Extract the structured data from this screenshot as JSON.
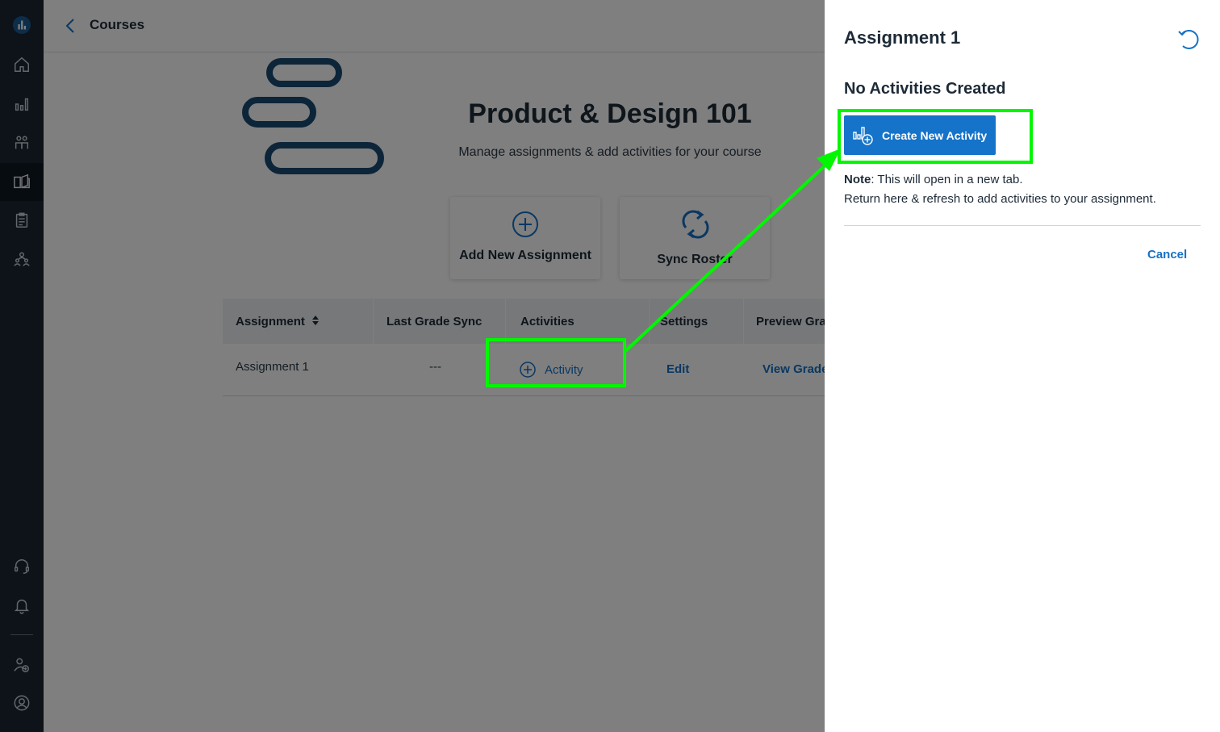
{
  "sidebar": {
    "logo": "analytics-logo",
    "items": [
      "home-icon",
      "chart-icon",
      "people-icon",
      "book-icon",
      "clipboard-icon",
      "group-icon"
    ],
    "bottom_items": [
      "headset-icon",
      "bell-icon",
      "add-user-icon",
      "account-icon"
    ]
  },
  "header": {
    "breadcrumb": "Courses"
  },
  "course": {
    "title": "Product & Design 101",
    "subtitle": "Manage assignments & add activities for your course"
  },
  "cards": [
    {
      "label": "Add New Assignment",
      "icon": "plus-circle-icon"
    },
    {
      "label": "Sync Roster",
      "icon": "sync-icon"
    }
  ],
  "table": {
    "headers": [
      "Assignment",
      "Last Grade Sync",
      "Activities",
      "Settings",
      "Preview Grad"
    ],
    "rows": [
      {
        "assignment": "Assignment 1",
        "last_sync": "---",
        "activity": "Activity",
        "settings": "Edit",
        "preview": "View  Grade"
      }
    ]
  },
  "panel": {
    "title": "Assignment 1",
    "heading": "No Activities Created",
    "button": "Create New Activity",
    "note_label": "Note",
    "note_text": ": This will open in a new tab.",
    "note_line2": "Return here & refresh to add activities to your assignment.",
    "cancel": "Cancel"
  },
  "colors": {
    "sidebar": "#1a2633",
    "accent": "#1573c9",
    "highlight": "#00f700",
    "logo": "#1b4a73"
  }
}
